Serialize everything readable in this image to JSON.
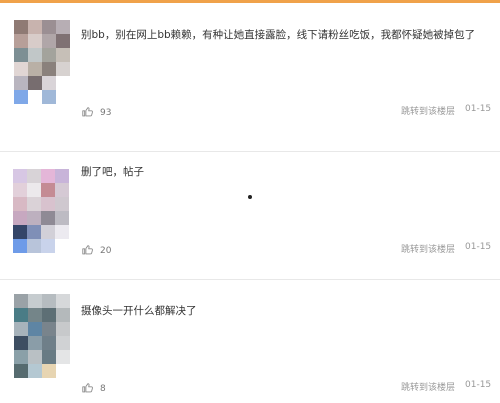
{
  "comments": [
    {
      "text": "别bb，别在网上bb赖赖，有种让她直接露脸，线下请粉丝吃饭，我都怀疑她被掉包了",
      "likes": "93",
      "jump_label": "跳转到该楼层",
      "date": "01-15",
      "avatar_colors": [
        "#8f7a74",
        "#c8b3ae",
        "#9b8f93",
        "#b7aeb4",
        "#b79f99",
        "#d8ccc9",
        "#b0a6a8",
        "#7f7173",
        "#7d8f94",
        "#c1c7c8",
        "#a3a39c",
        "#c6bfb7",
        "#e1d6d4",
        "#b9b0a6",
        "#8a817c",
        "#d7d2d0",
        "#b9b5bf",
        "#776d6f",
        "#d9d4d8",
        "#ffffff",
        "#7fa8e8",
        "#ffffff",
        "#a0b8d8",
        "#ffffff"
      ]
    },
    {
      "text": "删了吧，帖子",
      "likes": "20",
      "jump_label": "跳转到该楼层",
      "date": "01-15",
      "avatar_colors": [
        "#d7c7e4",
        "#d8d3d7",
        "#e4b6d8",
        "#c8b4d9",
        "#e2d0da",
        "#ece9ec",
        "#c48b94",
        "#d5c9d4",
        "#d8b9c4",
        "#dad2d7",
        "#d8c2ce",
        "#cfc8cf",
        "#c7a8c0",
        "#bdb0bf",
        "#8f8a95",
        "#bdbbc3",
        "#344568",
        "#7f8fb7",
        "#d2d0d8",
        "#eceaf0",
        "#6e9be8",
        "#b8c4da",
        "#c9d3eb",
        "#ffffff"
      ]
    },
    {
      "text": "摄像头一开什么都解决了",
      "likes": "8",
      "jump_label": "跳转到该楼层",
      "date": "01-15",
      "avatar_colors": [
        "#9aa2a7",
        "#c6cccf",
        "#b6bcc0",
        "#d6d8da",
        "#4a7c86",
        "#748589",
        "#5d6f75",
        "#b4b9bb",
        "#a7b3bb",
        "#5e85a4",
        "#79848c",
        "#c7c9cb",
        "#3d4e62",
        "#8a9da8",
        "#6f7f89",
        "#d0d2d4",
        "#8aa0a8",
        "#b9c0c4",
        "#687b84",
        "#e4e5e6",
        "#566b6f",
        "#b4c8d2",
        "#e7d5b2",
        "#ffffff"
      ]
    }
  ],
  "colors": {
    "accent": "#f0a24a",
    "text": "#333333",
    "meta": "#999999"
  },
  "icons": {
    "like": "thumbs-up-icon"
  }
}
